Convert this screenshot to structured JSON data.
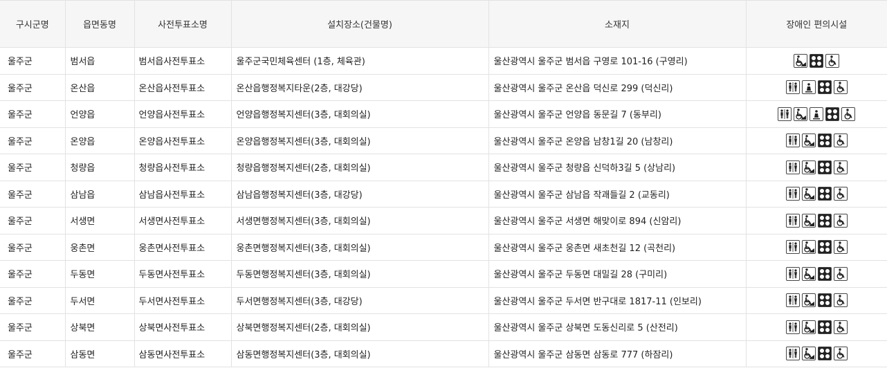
{
  "headers": [
    "구시군명",
    "읍면동명",
    "사전투표소명",
    "설치장소(건물명)",
    "소재지",
    "장애인 편의시설"
  ],
  "rows": [
    {
      "sigungu": "울주군",
      "eupmyeondong": "범서읍",
      "station": "범서읍사전투표소",
      "place": "울주군국민체육센터 (1층, 체육관)",
      "address": "울산광역시 울주군 범서읍 구영로 101-16 (구영리)",
      "facilities": [
        "wheelchair-ramp-icon",
        "braille-block-icon",
        "wheelchair-icon"
      ]
    },
    {
      "sigungu": "울주군",
      "eupmyeondong": "온산읍",
      "station": "온산읍사전투표소",
      "place": "온산읍행정복지타운(2층, 대강당)",
      "address": "울산광역시 울주군 온산읍 덕신로 299 (덕신리)",
      "facilities": [
        "accessible-toilet-icon",
        "elevator-icon",
        "braille-block-icon",
        "wheelchair-icon"
      ]
    },
    {
      "sigungu": "울주군",
      "eupmyeondong": "언양읍",
      "station": "언양읍사전투표소",
      "place": "언양읍행정복지센터(3층, 대회의실)",
      "address": "울산광역시 울주군 언양읍 동문길 7 (동부리)",
      "facilities": [
        "accessible-toilet-icon",
        "wheelchair-ramp-icon",
        "elevator-icon",
        "braille-block-icon",
        "wheelchair-icon"
      ]
    },
    {
      "sigungu": "울주군",
      "eupmyeondong": "온양읍",
      "station": "온양읍사전투표소",
      "place": "온양읍행정복지센터(3층, 대회의실)",
      "address": "울산광역시 울주군 온양읍 남창1길 20 (남창리)",
      "facilities": [
        "accessible-toilet-icon",
        "wheelchair-ramp-icon",
        "braille-block-icon",
        "wheelchair-icon"
      ]
    },
    {
      "sigungu": "울주군",
      "eupmyeondong": "청량읍",
      "station": "청량읍사전투표소",
      "place": "청량읍행정복지센터(2층, 대회의실)",
      "address": "울산광역시 울주군 청량읍 신덕하3길 5 (상남리)",
      "facilities": [
        "accessible-toilet-icon",
        "wheelchair-ramp-icon",
        "braille-block-icon",
        "wheelchair-icon"
      ]
    },
    {
      "sigungu": "울주군",
      "eupmyeondong": "삼남읍",
      "station": "삼남읍사전투표소",
      "place": "삼남읍행정복지센터(3층, 대강당)",
      "address": "울산광역시 울주군 삼남읍 작괘들길 2 (교동리)",
      "facilities": [
        "accessible-toilet-icon",
        "wheelchair-ramp-icon",
        "braille-block-icon",
        "wheelchair-icon"
      ]
    },
    {
      "sigungu": "울주군",
      "eupmyeondong": "서생면",
      "station": "서생면사전투표소",
      "place": "서생면행정복지센터(3층, 대회의실)",
      "address": "울산광역시 울주군 서생면 해맞이로 894 (신암리)",
      "facilities": [
        "accessible-toilet-icon",
        "wheelchair-ramp-icon",
        "braille-block-icon",
        "wheelchair-icon"
      ]
    },
    {
      "sigungu": "울주군",
      "eupmyeondong": "웅촌면",
      "station": "웅촌면사전투표소",
      "place": "웅촌면행정복지센터(3층, 대회의실)",
      "address": "울산광역시 울주군 웅촌면 새초천길 12 (곡천리)",
      "facilities": [
        "accessible-toilet-icon",
        "wheelchair-ramp-icon",
        "braille-block-icon",
        "wheelchair-icon"
      ]
    },
    {
      "sigungu": "울주군",
      "eupmyeondong": "두동면",
      "station": "두동면사전투표소",
      "place": "두동면행정복지센터(3층, 대회의실)",
      "address": "울산광역시 울주군 두동면 대밀길 28 (구미리)",
      "facilities": [
        "accessible-toilet-icon",
        "wheelchair-ramp-icon",
        "braille-block-icon",
        "wheelchair-icon"
      ]
    },
    {
      "sigungu": "울주군",
      "eupmyeondong": "두서면",
      "station": "두서면사전투표소",
      "place": "두서면행정복지센터(3층, 대강당)",
      "address": "울산광역시 울주군 두서면 반구대로 1817-11 (인보리)",
      "facilities": [
        "accessible-toilet-icon",
        "wheelchair-ramp-icon",
        "braille-block-icon",
        "wheelchair-icon"
      ]
    },
    {
      "sigungu": "울주군",
      "eupmyeondong": "상북면",
      "station": "상북면사전투표소",
      "place": "상북면행정복지센터(2층, 대회의실)",
      "address": "울산광역시 울주군 상북면 도동신리로 5 (산전리)",
      "facilities": [
        "accessible-toilet-icon",
        "wheelchair-ramp-icon",
        "braille-block-icon",
        "wheelchair-icon"
      ]
    },
    {
      "sigungu": "울주군",
      "eupmyeondong": "삼동면",
      "station": "삼동면사전투표소",
      "place": "삼동면행정복지센터(3층, 대회의실)",
      "address": "울산광역시 울주군 삼동면 삼동로 777 (하잠리)",
      "facilities": [
        "accessible-toilet-icon",
        "wheelchair-ramp-icon",
        "braille-block-icon",
        "wheelchair-icon"
      ]
    }
  ]
}
